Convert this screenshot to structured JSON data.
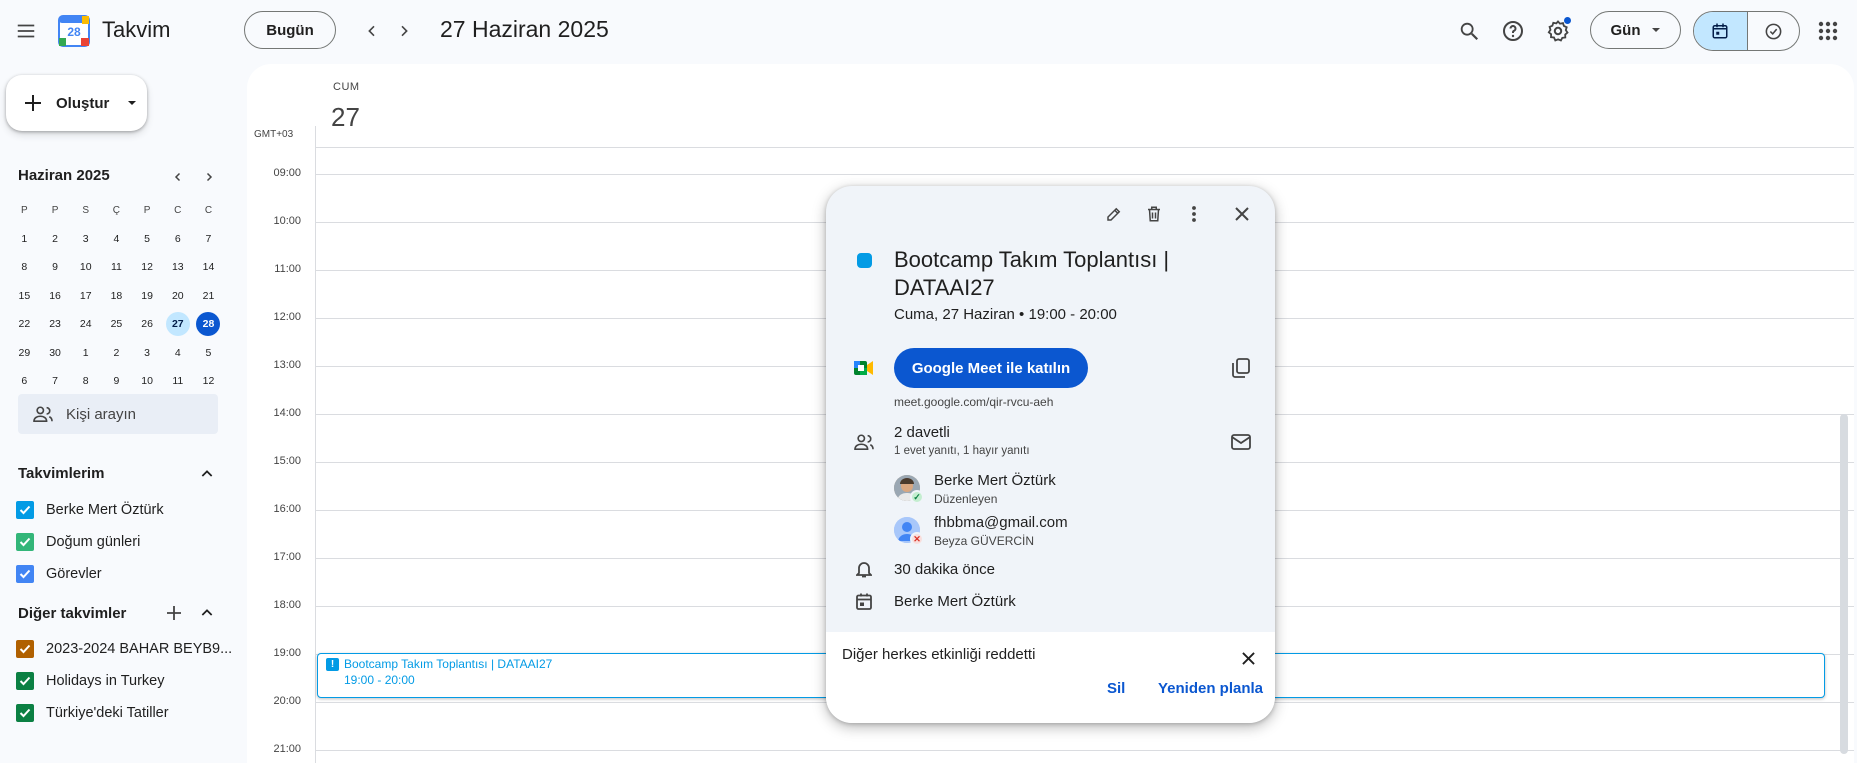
{
  "header": {
    "app_title": "Takvim",
    "logo_day": "28",
    "today_label": "Bugün",
    "date_title": "27 Haziran 2025",
    "view_label": "Gün"
  },
  "sidebar": {
    "create_label": "Oluştur",
    "mini_calendar": {
      "title": "Haziran 2025",
      "weekdays": [
        "P",
        "P",
        "S",
        "Ç",
        "P",
        "C",
        "C"
      ],
      "weeks": [
        [
          "1",
          "2",
          "3",
          "4",
          "5",
          "6",
          "7"
        ],
        [
          "8",
          "9",
          "10",
          "11",
          "12",
          "13",
          "14"
        ],
        [
          "15",
          "16",
          "17",
          "18",
          "19",
          "20",
          "21"
        ],
        [
          "22",
          "23",
          "24",
          "25",
          "26",
          "27",
          "28"
        ],
        [
          "29",
          "30",
          "1",
          "2",
          "3",
          "4",
          "5"
        ],
        [
          "6",
          "7",
          "8",
          "9",
          "10",
          "11",
          "12"
        ]
      ],
      "selected_day": "27",
      "today_day": "28"
    },
    "people_search_placeholder": "Kişi arayın",
    "my_calendars_title": "Takvimlerim",
    "my_calendars": [
      {
        "label": "Berke Mert Öztürk",
        "color": "#039be5"
      },
      {
        "label": "Doğum günleri",
        "color": "#33b679"
      },
      {
        "label": "Görevler",
        "color": "#4285f4"
      }
    ],
    "other_calendars_title": "Diğer takvimler",
    "other_calendars": [
      {
        "label": "2023-2024 BAHAR BEYB9...",
        "color": "#b06000"
      },
      {
        "label": "Holidays in Turkey",
        "color": "#0b8043"
      },
      {
        "label": "Türkiye'deki Tatiller",
        "color": "#0b8043"
      }
    ]
  },
  "main": {
    "day_name": "CUM",
    "day_number": "27",
    "timezone": "GMT+03",
    "hours": [
      "09:00",
      "10:00",
      "11:00",
      "12:00",
      "13:00",
      "14:00",
      "15:00",
      "16:00",
      "17:00",
      "18:00",
      "19:00",
      "20:00",
      "21:00"
    ],
    "event": {
      "title": "Bootcamp Takım Toplantısı | DATAAI27",
      "time": "19:00 - 20:00",
      "color": "#039be5"
    }
  },
  "popup": {
    "title": "Bootcamp Takım Toplantısı | DATAAI27",
    "when": "Cuma, 27 Haziran  •  19:00 - 20:00",
    "meet_button": "Google Meet ile katılın",
    "meet_url": "meet.google.com/qir-rvcu-aeh",
    "guests_count": "2 davetli",
    "guests_summary": "1 evet yanıtı, 1 hayır yanıtı",
    "guests": [
      {
        "name": "Berke Mert Öztürk",
        "sub": "Düzenleyen",
        "status": "accepted"
      },
      {
        "name": "fhbbma@gmail.com",
        "sub": "Beyza GÜVERCİN",
        "status": "declined"
      }
    ],
    "reminder": "30 dakika önce",
    "calendar_owner": "Berke Mert Öztürk",
    "notice": "Diğer herkes etkinliği reddetti",
    "delete_label": "Sil",
    "reschedule_label": "Yeniden planla"
  },
  "colors": {
    "accent": "#0b57d0",
    "event": "#039be5",
    "selected": "#c2e7ff"
  }
}
